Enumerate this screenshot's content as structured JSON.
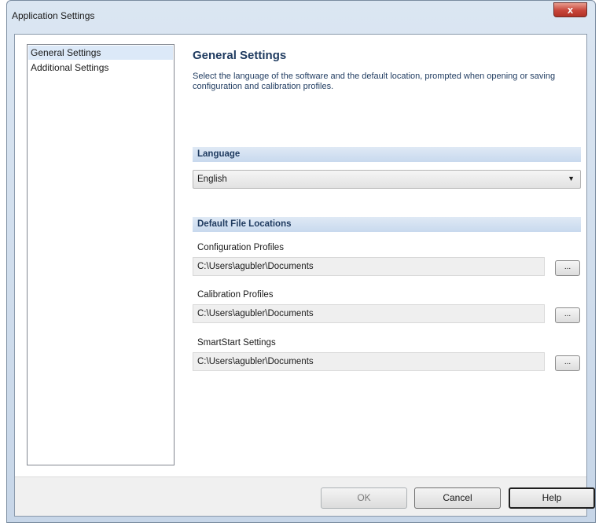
{
  "window": {
    "title": "Application Settings",
    "close_label": "x"
  },
  "sidebar": {
    "items": [
      {
        "label": "General Settings",
        "selected": true
      },
      {
        "label": "Additional Settings",
        "selected": false
      }
    ]
  },
  "main": {
    "title": "General Settings",
    "description": "Select the language of the software and the default location, prompted when opening or saving configuration and calibration profiles.",
    "language": {
      "header": "Language",
      "selected": "English"
    },
    "file_locations": {
      "header": "Default File Locations",
      "browse_label": "...",
      "fields": [
        {
          "label": "Configuration Profiles",
          "value": "C:\\Users\\agubler\\Documents"
        },
        {
          "label": "Calibration Profiles",
          "value": "C:\\Users\\agubler\\Documents"
        },
        {
          "label": "SmartStart Settings",
          "value": "C:\\Users\\agubler\\Documents"
        }
      ]
    }
  },
  "footer": {
    "ok_label": "OK",
    "cancel_label": "Cancel",
    "help_label": "Help"
  }
}
